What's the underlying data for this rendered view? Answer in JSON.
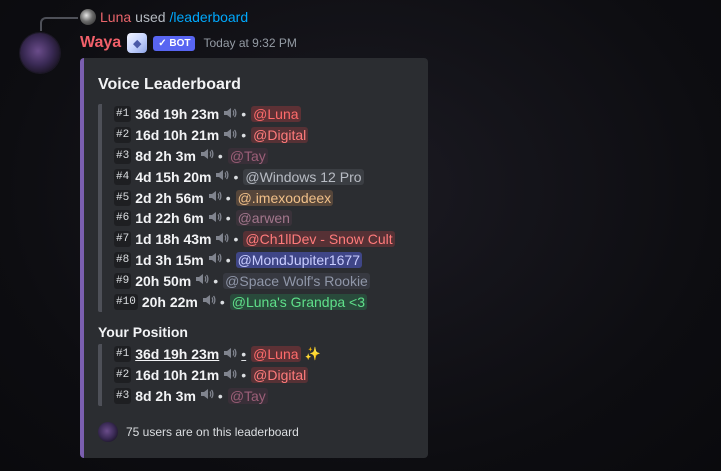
{
  "reply": {
    "user": "Luna",
    "verb": "used",
    "command": "/leaderboard"
  },
  "header": {
    "author": "Waya",
    "bot_tag": "✓ BOT",
    "timestamp": "Today at 9:32 PM"
  },
  "embed": {
    "title": "Voice Leaderboard",
    "accent": "#7b5fb0",
    "rows": [
      {
        "rank": "#1",
        "time": "36d 19h 23m",
        "user": "@Luna",
        "color": "#ff6b6b",
        "bg": "rgba(242,63,67,0.25)"
      },
      {
        "rank": "#2",
        "time": "16d 10h 21m",
        "user": "@Digital",
        "color": "#ff7b7b",
        "bg": "rgba(242,63,67,0.22)"
      },
      {
        "rank": "#3",
        "time": "8d 2h 3m",
        "user": "@Tay",
        "color": "#9c5f78",
        "bg": "rgba(120,60,90,0.18)"
      },
      {
        "rank": "#4",
        "time": "4d 15h 20m",
        "user": "@Windows 12 Pro",
        "color": "#b8bcc4",
        "bg": "rgba(120,124,132,0.22)"
      },
      {
        "rank": "#5",
        "time": "2d 2h 56m",
        "user": "@.imexoodeex",
        "color": "#f0c089",
        "bg": "rgba(240,160,90,0.22)"
      },
      {
        "rank": "#6",
        "time": "1d 22h 6m",
        "user": "@arwen",
        "color": "#a2768c",
        "bg": "rgba(130,80,100,0.18)"
      },
      {
        "rank": "#7",
        "time": "1d 18h 43m",
        "user": "@Ch1llDev - Snow Cult",
        "color": "#ff7b7b",
        "bg": "rgba(242,63,67,0.22)"
      },
      {
        "rank": "#8",
        "time": "1d 3h 15m",
        "user": "@MondJupiter1677",
        "color": "#c9cdff",
        "bg": "rgba(88,101,242,0.45)"
      },
      {
        "rank": "#9",
        "time": "20h 50m",
        "user": "@Space Wolf's Rookie",
        "color": "#8f96a8",
        "bg": "rgba(110,118,140,0.18)"
      },
      {
        "rank": "#10",
        "time": "20h 22m",
        "user": "@Luna's Grandpa <3",
        "color": "#5fe08a",
        "bg": "rgba(35,165,90,0.25)"
      }
    ],
    "your_position_title": "Your Position",
    "position_rows": [
      {
        "rank": "#1",
        "time": "36d 19h 23m",
        "user": "@Luna",
        "color": "#ff6b6b",
        "bg": "rgba(242,63,67,0.25)",
        "highlight": true
      },
      {
        "rank": "#2",
        "time": "16d 10h 21m",
        "user": "@Digital",
        "color": "#ff7b7b",
        "bg": "rgba(242,63,67,0.22)"
      },
      {
        "rank": "#3",
        "time": "8d 2h 3m",
        "user": "@Tay",
        "color": "#9c5f78",
        "bg": "rgba(120,60,90,0.18)"
      }
    ],
    "sparkle": "✨",
    "separator": "•",
    "speaker_icon": "speaker-icon",
    "footer_text": "75 users are on this leaderboard"
  }
}
